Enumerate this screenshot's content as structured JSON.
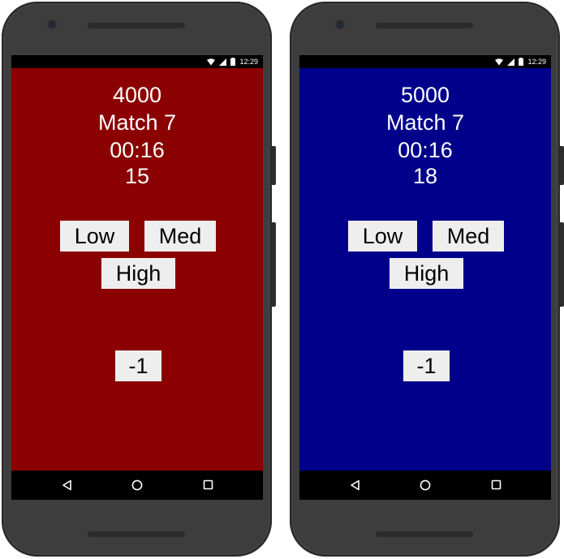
{
  "status_bar": {
    "time": "12:29"
  },
  "nav_bar": {
    "back_icon": "back-triangle-icon",
    "home_icon": "home-circle-icon",
    "recents_icon": "recents-square-icon"
  },
  "devices": [
    {
      "background_color": "#8b0000",
      "score": "4000",
      "match": "Match 7",
      "timer": "00:16",
      "count": "15",
      "buttons": {
        "low": "Low",
        "med": "Med",
        "high": "High",
        "minus": "-1"
      }
    },
    {
      "background_color": "#00008b",
      "score": "5000",
      "match": "Match 7",
      "timer": "00:16",
      "count": "18",
      "buttons": {
        "low": "Low",
        "med": "Med",
        "high": "High",
        "minus": "-1"
      }
    }
  ]
}
